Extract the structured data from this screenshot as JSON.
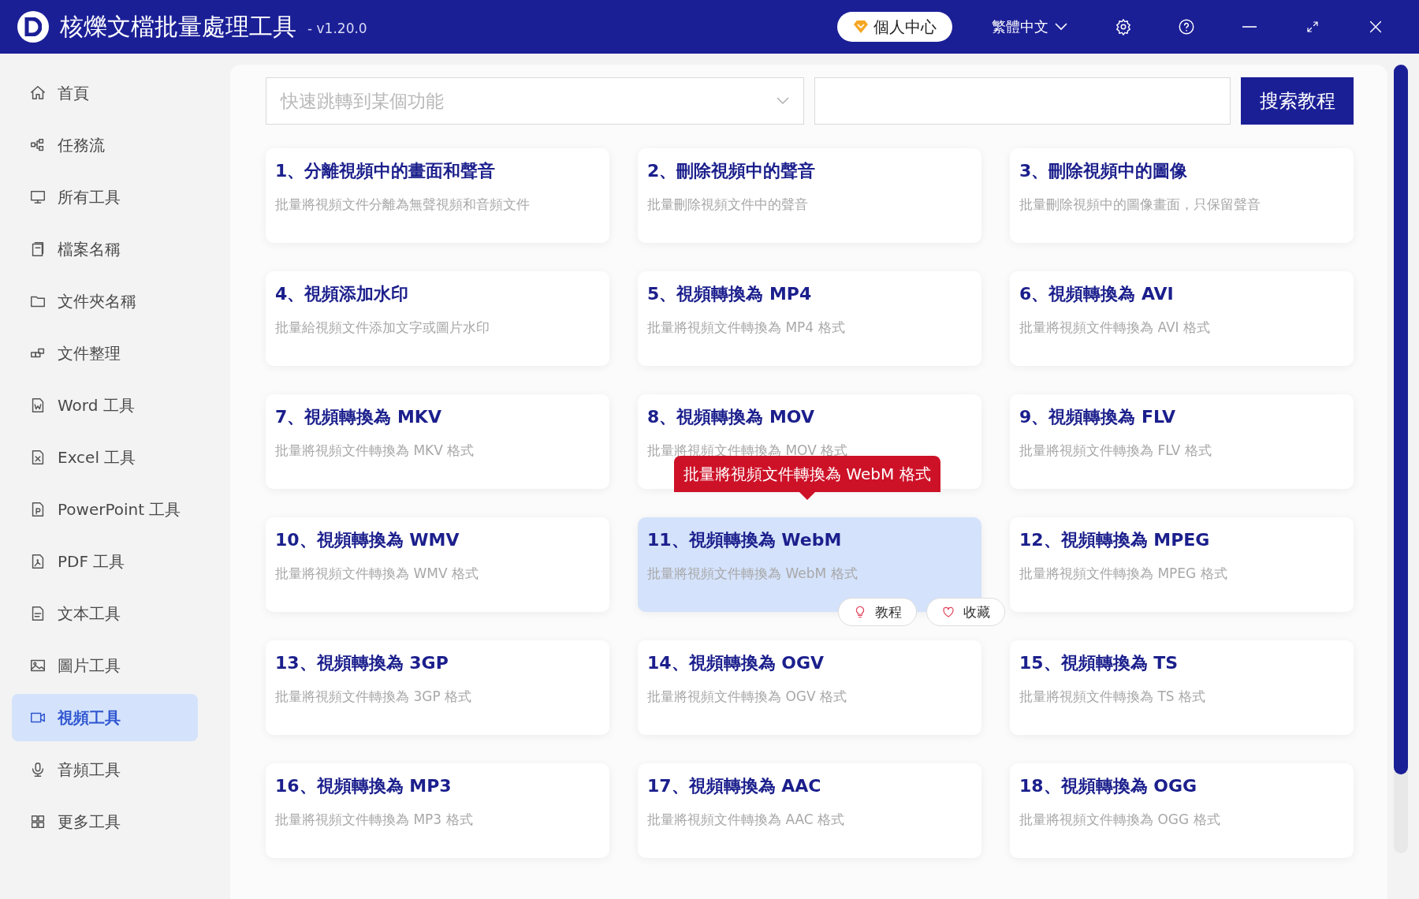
{
  "window": {
    "title": "核爍文檔批量處理工具",
    "version": "- v1.20.0",
    "user_button": "個人中心",
    "language": "繁體中文"
  },
  "sidebar": {
    "items": [
      {
        "label": "首頁",
        "selected": false
      },
      {
        "label": "任務流",
        "selected": false
      },
      {
        "label": "所有工具",
        "selected": false
      },
      {
        "label": "檔案名稱",
        "selected": false
      },
      {
        "label": "文件夾名稱",
        "selected": false
      },
      {
        "label": "文件整理",
        "selected": false
      },
      {
        "label": "Word 工具",
        "selected": false
      },
      {
        "label": "Excel 工具",
        "selected": false
      },
      {
        "label": "PowerPoint 工具",
        "selected": false
      },
      {
        "label": "PDF 工具",
        "selected": false
      },
      {
        "label": "文本工具",
        "selected": false
      },
      {
        "label": "圖片工具",
        "selected": false
      },
      {
        "label": "視頻工具",
        "selected": true
      },
      {
        "label": "音頻工具",
        "selected": false
      },
      {
        "label": "更多工具",
        "selected": false
      }
    ]
  },
  "search": {
    "jump_placeholder": "快速跳轉到某個功能",
    "search_button": "搜索教程"
  },
  "cards": [
    {
      "title": "1、分離視頻中的畫面和聲音",
      "description": "批量將視頻文件分離為無聲視頻和音頻文件",
      "hovered": false
    },
    {
      "title": "2、刪除視頻中的聲音",
      "description": "批量刪除視頻文件中的聲音",
      "hovered": false
    },
    {
      "title": "3、刪除視頻中的圖像",
      "description": "批量刪除視頻中的圖像畫面，只保留聲音",
      "hovered": false
    },
    {
      "title": "4、視頻添加水印",
      "description": "批量給視頻文件添加文字或圖片水印",
      "hovered": false
    },
    {
      "title": "5、視頻轉換為 MP4",
      "description": "批量將視頻文件轉換為 MP4 格式",
      "hovered": false
    },
    {
      "title": "6、視頻轉換為 AVI",
      "description": "批量將視頻文件轉換為 AVI 格式",
      "hovered": false
    },
    {
      "title": "7、視頻轉換為 MKV",
      "description": "批量將視頻文件轉換為 MKV 格式",
      "hovered": false
    },
    {
      "title": "8、視頻轉換為 MOV",
      "description": "批量將視頻文件轉換為 MOV 格式",
      "hovered": false
    },
    {
      "title": "9、視頻轉換為 FLV",
      "description": "批量將視頻文件轉換為 FLV 格式",
      "hovered": false
    },
    {
      "title": "10、視頻轉換為 WMV",
      "description": "批量將視頻文件轉換為 WMV 格式",
      "hovered": false
    },
    {
      "title": "11、視頻轉換為 WebM",
      "description": "批量將視頻文件轉換為 WebM 格式",
      "hovered": true,
      "actions": [
        "教程",
        "收藏"
      ]
    },
    {
      "title": "12、視頻轉換為 MPEG",
      "description": "批量將視頻文件轉換為 MPEG 格式",
      "hovered": false
    },
    {
      "title": "13、視頻轉換為 3GP",
      "description": "批量將視頻文件轉換為 3GP 格式",
      "hovered": false
    },
    {
      "title": "14、視頻轉換為 OGV",
      "description": "批量將視頻文件轉換為 OGV 格式",
      "hovered": false
    },
    {
      "title": "15、視頻轉換為 TS",
      "description": "批量將視頻文件轉換為 TS 格式",
      "hovered": false
    },
    {
      "title": "16、視頻轉換為 MP3",
      "description": "批量將視頻文件轉換為 MP3 格式",
      "hovered": false
    },
    {
      "title": "17、視頻轉換為 AAC",
      "description": "批量將視頻文件轉換為 AAC 格式",
      "hovered": false
    },
    {
      "title": "18、視頻轉換為 OGG",
      "description": "批量將視頻文件轉換為 OGG 格式",
      "hovered": false
    }
  ],
  "tooltip": "批量將視頻文件轉換為 WebM 格式"
}
